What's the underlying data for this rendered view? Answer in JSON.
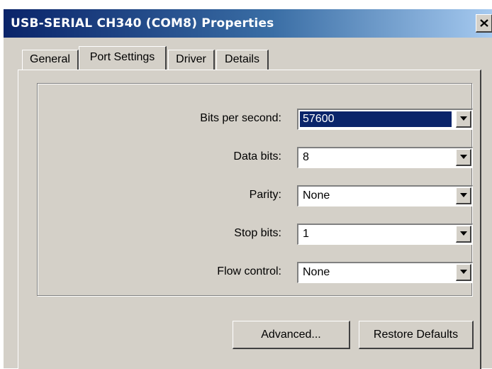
{
  "window": {
    "title": "USB-SERIAL CH340 (COM8) Properties"
  },
  "tabs": [
    {
      "label": "General",
      "active": false
    },
    {
      "label": "Port Settings",
      "active": true
    },
    {
      "label": "Driver",
      "active": false
    },
    {
      "label": "Details",
      "active": false
    }
  ],
  "port_settings": {
    "bits_per_second": {
      "label": "Bits per second:",
      "value": "57600"
    },
    "data_bits": {
      "label": "Data bits:",
      "value": "8"
    },
    "parity": {
      "label": "Parity:",
      "value": "None"
    },
    "stop_bits": {
      "label": "Stop bits:",
      "value": "1"
    },
    "flow_control": {
      "label": "Flow control:",
      "value": "None"
    }
  },
  "buttons": {
    "advanced": "Advanced...",
    "restore_defaults": "Restore Defaults"
  },
  "icons": {
    "close": "close-icon",
    "dropdown": "chevron-down-icon"
  },
  "colors": {
    "title_start": "#0a246a",
    "title_end": "#a6caf0",
    "face": "#d4d0c8",
    "selection": "#0a246a"
  }
}
